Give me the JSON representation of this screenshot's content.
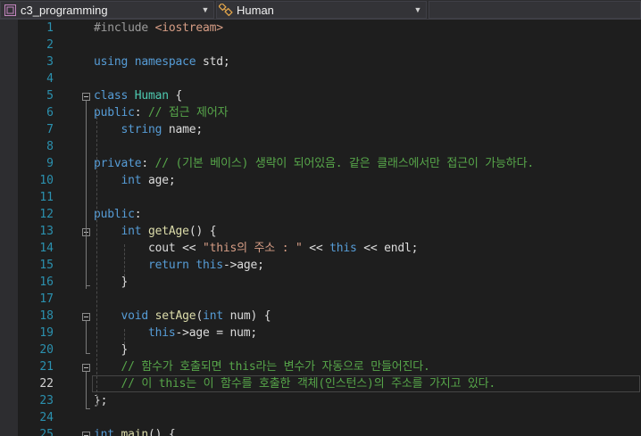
{
  "nav": {
    "project": "c3_programming",
    "scope": "Human",
    "member": ""
  },
  "current_line": 22,
  "colors": {
    "keyword": "#569cd6",
    "type": "#4ec9b0",
    "comment": "#57a64a",
    "string": "#d69d85",
    "preprocessor": "#9b9b9b",
    "line_number": "#2b91af",
    "text": "#dcdcdc"
  },
  "lines": [
    {
      "n": "1",
      "tokens": [
        [
          "pp",
          "#include "
        ],
        [
          "str",
          "<iostream>"
        ]
      ]
    },
    {
      "n": "2",
      "tokens": []
    },
    {
      "n": "3",
      "tokens": [
        [
          "kw",
          "using"
        ],
        [
          "",
          " "
        ],
        [
          "kw",
          "namespace"
        ],
        [
          "",
          " std;"
        ]
      ]
    },
    {
      "n": "4",
      "tokens": []
    },
    {
      "n": "5",
      "tokens": [
        [
          "kw",
          "class"
        ],
        [
          "",
          " "
        ],
        [
          "ty",
          "Human"
        ],
        [
          "",
          " {"
        ]
      ]
    },
    {
      "n": "6",
      "tokens": [
        [
          "kw",
          "public"
        ],
        [
          "",
          ": "
        ],
        [
          "cm",
          "// 접근 제어자"
        ]
      ]
    },
    {
      "n": "7",
      "tokens": [
        [
          "",
          "    "
        ],
        [
          "kw",
          "string"
        ],
        [
          "",
          " name;"
        ]
      ]
    },
    {
      "n": "8",
      "tokens": []
    },
    {
      "n": "9",
      "tokens": [
        [
          "kw",
          "private"
        ],
        [
          "",
          ": "
        ],
        [
          "cm",
          "// (기본 베이스) 생략이 되어있음. 같은 클래스에서만 접근이 가능하다."
        ]
      ]
    },
    {
      "n": "10",
      "tokens": [
        [
          "",
          "    "
        ],
        [
          "kw",
          "int"
        ],
        [
          "",
          " age;"
        ]
      ]
    },
    {
      "n": "11",
      "tokens": []
    },
    {
      "n": "12",
      "tokens": [
        [
          "kw",
          "public"
        ],
        [
          "",
          ":"
        ]
      ]
    },
    {
      "n": "13",
      "tokens": [
        [
          "",
          "    "
        ],
        [
          "kw",
          "int"
        ],
        [
          "",
          " "
        ],
        [
          "fn",
          "getAge"
        ],
        [
          "",
          "() {"
        ]
      ]
    },
    {
      "n": "14",
      "tokens": [
        [
          "",
          "        cout << "
        ],
        [
          "str",
          "\"this의 주소 : \""
        ],
        [
          "",
          " << "
        ],
        [
          "kw",
          "this"
        ],
        [
          "",
          " << endl;"
        ]
      ]
    },
    {
      "n": "15",
      "tokens": [
        [
          "",
          "        "
        ],
        [
          "kw",
          "return"
        ],
        [
          "",
          " "
        ],
        [
          "kw",
          "this"
        ],
        [
          "",
          "->age;"
        ]
      ]
    },
    {
      "n": "16",
      "tokens": [
        [
          "",
          "    }"
        ]
      ]
    },
    {
      "n": "17",
      "tokens": []
    },
    {
      "n": "18",
      "tokens": [
        [
          "",
          "    "
        ],
        [
          "kw",
          "void"
        ],
        [
          "",
          " "
        ],
        [
          "fn",
          "setAge"
        ],
        [
          "",
          "("
        ],
        [
          "kw",
          "int"
        ],
        [
          "",
          " num) {"
        ]
      ]
    },
    {
      "n": "19",
      "tokens": [
        [
          "",
          "        "
        ],
        [
          "kw",
          "this"
        ],
        [
          "",
          "->age = num;"
        ]
      ]
    },
    {
      "n": "20",
      "tokens": [
        [
          "",
          "    }"
        ]
      ]
    },
    {
      "n": "21",
      "tokens": [
        [
          "",
          "    "
        ],
        [
          "cm",
          "// 함수가 호출되면 this라는 변수가 자동으로 만들어진다."
        ]
      ]
    },
    {
      "n": "22",
      "tokens": [
        [
          "",
          "    "
        ],
        [
          "cm",
          "// 이 this는 이 함수를 호출한 객체(인스턴스)의 주소를 가지고 있다."
        ]
      ]
    },
    {
      "n": "23",
      "tokens": [
        [
          "",
          "};"
        ]
      ]
    },
    {
      "n": "24",
      "tokens": []
    },
    {
      "n": "25",
      "tokens": [
        [
          "kw",
          "int"
        ],
        [
          "",
          " "
        ],
        [
          "fn",
          "main"
        ],
        [
          "",
          "() {"
        ]
      ]
    }
  ]
}
